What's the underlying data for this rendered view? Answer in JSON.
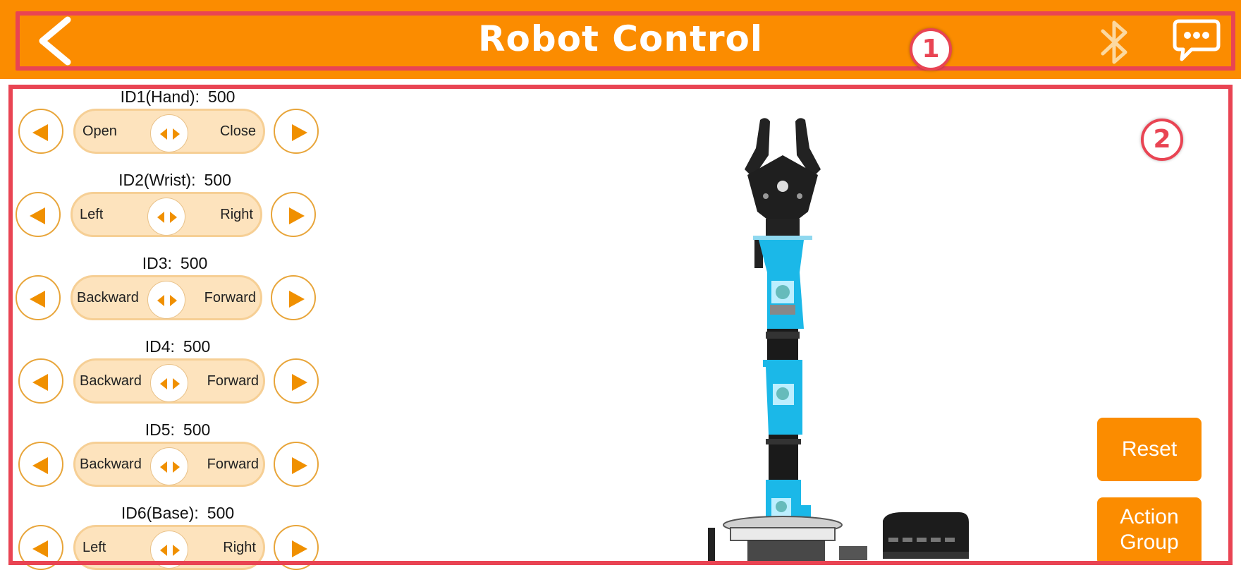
{
  "header": {
    "title": "Robot Control",
    "badge_1": "1"
  },
  "main": {
    "badge_2": "2"
  },
  "servos": [
    {
      "label": "ID1(Hand):",
      "value": "500",
      "left": "Open",
      "right": "Close"
    },
    {
      "label": "ID2(Wrist):",
      "value": "500",
      "left": "Left",
      "right": "Right"
    },
    {
      "label": "ID3:",
      "value": "500",
      "left": "Backward",
      "right": "Forward"
    },
    {
      "label": "ID4:",
      "value": "500",
      "left": "Backward",
      "right": "Forward"
    },
    {
      "label": "ID5:",
      "value": "500",
      "left": "Backward",
      "right": "Forward"
    },
    {
      "label": "ID6(Base):",
      "value": "500",
      "left": "Left",
      "right": "Right"
    }
  ],
  "buttons": {
    "reset": "Reset",
    "action_group_line1": "Action",
    "action_group_line2": "Group"
  },
  "colors": {
    "header": "#fb8c00",
    "annotation": "#e94453",
    "slider_bg": "#fde3bd",
    "arm_blue": "#1bb8e8"
  },
  "icons": [
    "back-arrow-icon",
    "bluetooth-icon",
    "message-icon",
    "left-triangle-icon",
    "right-triangle-icon"
  ]
}
